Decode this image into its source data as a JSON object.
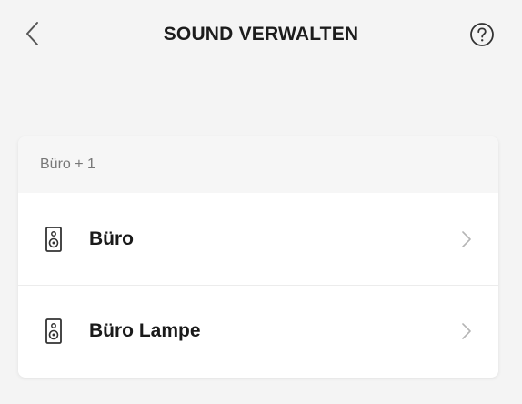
{
  "header": {
    "title": "SOUND VERWALTEN",
    "back_icon": "chevron-left-icon",
    "help_icon": "question-circle-icon"
  },
  "group": {
    "name": "Büro + 1",
    "rooms": [
      {
        "label": "Büro",
        "icon": "speaker-icon"
      },
      {
        "label": "Büro Lampe",
        "icon": "speaker-icon"
      }
    ]
  },
  "colors": {
    "background": "#f4f4f4",
    "card": "#ffffff",
    "group_header": "#f6f6f6",
    "muted_text": "#777777",
    "primary_text": "#1a1a1a"
  }
}
